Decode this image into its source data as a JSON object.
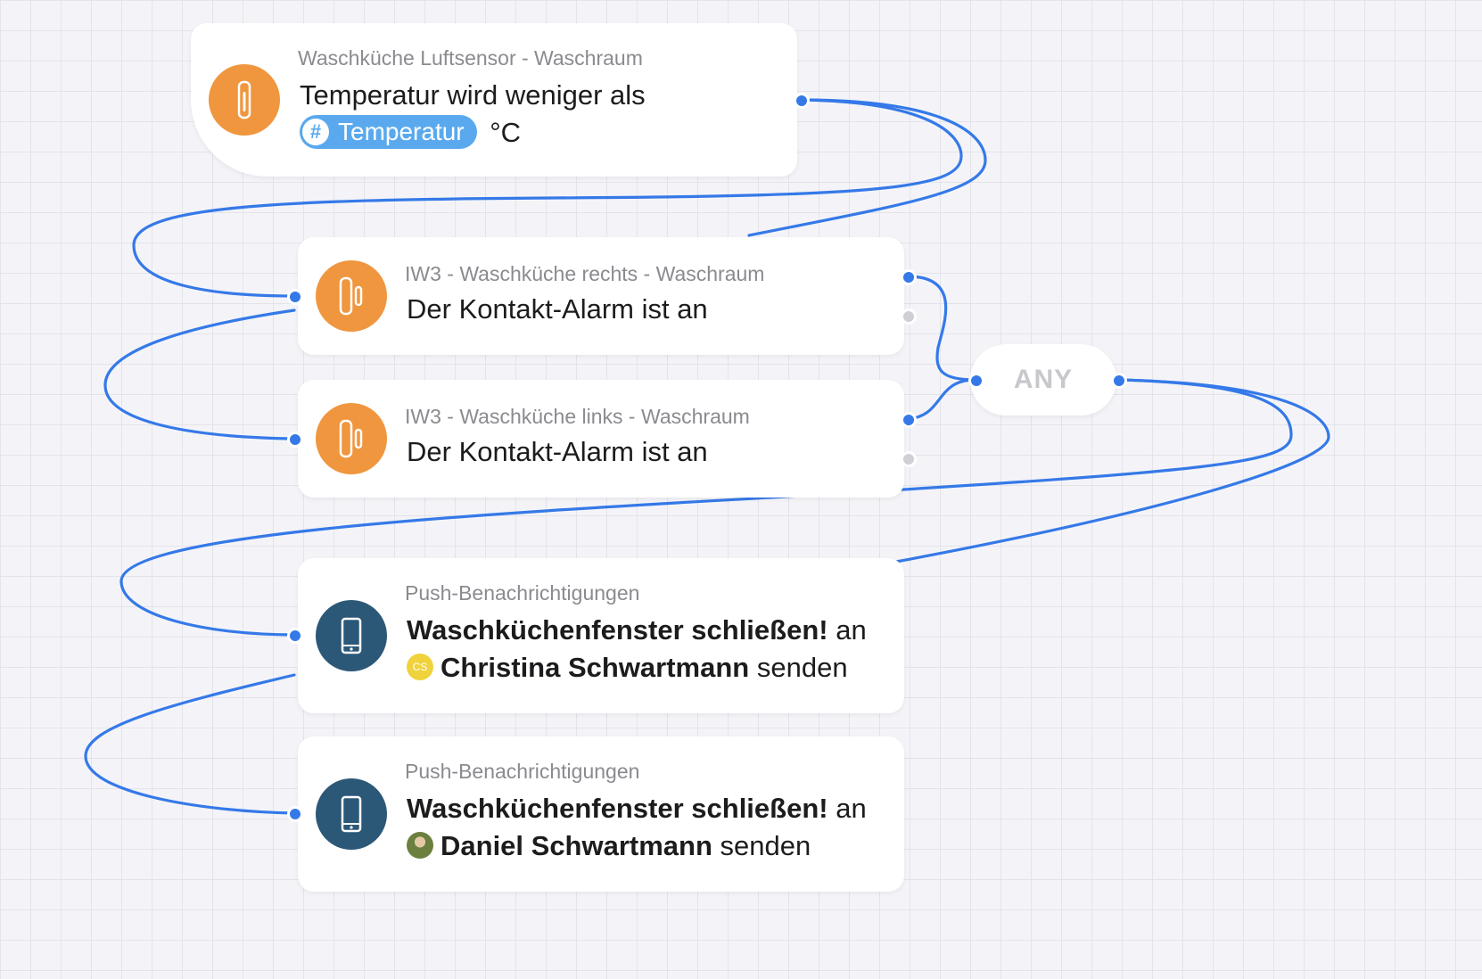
{
  "colors": {
    "wire": "#3579e8",
    "trigger_icon": "#f0963e",
    "action_icon": "#2c5878",
    "variable_pill": "#5aa9ee"
  },
  "nodes": {
    "temp_trigger": {
      "subtitle": "Waschküche Luftsensor - Waschraum",
      "text": "Temperatur wird weniger als",
      "variable": "Temperatur",
      "unit": "°C",
      "icon": "thermometer-icon"
    },
    "contact_right": {
      "subtitle": "IW3 - Waschküche rechts - Waschraum",
      "text": "Der Kontakt-Alarm ist an",
      "icon": "contact-sensor-icon"
    },
    "contact_left": {
      "subtitle": "IW3 - Waschküche links - Waschraum",
      "text": "Der Kontakt-Alarm ist an",
      "icon": "contact-sensor-icon"
    },
    "any_gate": {
      "label": "ANY"
    },
    "push_1": {
      "subtitle": "Push-Benachrichtigungen",
      "message": "Waschküchenfenster schließen!",
      "to_word": "an",
      "avatar_initials": "CS",
      "recipient": "Christina Schwartmann",
      "send_word": "senden",
      "icon": "phone-icon"
    },
    "push_2": {
      "subtitle": "Push-Benachrichtigungen",
      "message": "Waschküchenfenster schließen!",
      "to_word": "an",
      "recipient": "Daniel Schwartmann",
      "send_word": "senden",
      "icon": "phone-icon"
    }
  }
}
